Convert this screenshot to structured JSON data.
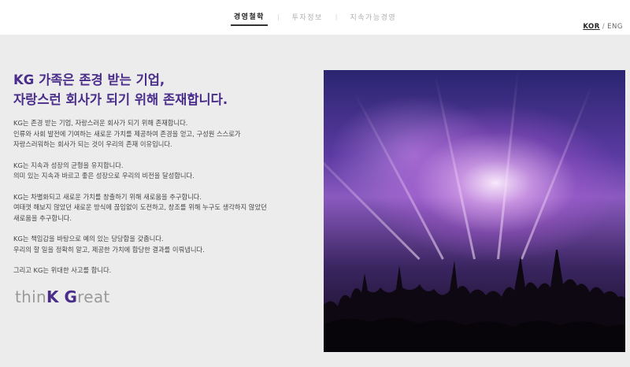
{
  "nav": {
    "items": [
      {
        "label": "경영철학",
        "active": true
      },
      {
        "label": "투자정보",
        "active": false
      },
      {
        "label": "지속가능경영",
        "active": false
      }
    ]
  },
  "lang": {
    "kor": "KOR",
    "separator": "/",
    "eng": "ENG"
  },
  "heading": {
    "line1": "KG 가족은 존경 받는 기업,",
    "line2": "자랑스런 회사가 되기 위해 존재합니다."
  },
  "paragraphs": [
    [
      "KG는 존경 받는 기업, 자랑스러운 회사가 되기 위해 존재합니다.",
      "인류와 사회 발전에 기여하는 새로운 가치를 제공하여 존경을 얻고, 구성원 스스로가",
      "자랑스러워하는 회사가 되는 것이 우리의 존재 이유입니다."
    ],
    [
      "KG는 지속과 성장의 균형을 유지합니다.",
      "의미 있는 지속과 바르고 좋은 성장으로 우리의 비전을 달성합니다."
    ],
    [
      "KG는 차별화되고 새로운 가치를 창출하기 위해 새로움을 추구합니다.",
      "여태껏 해보지 않았던 새로운 방식에 끊임없이 도전하고, 창조를 위해 누구도 생각하지 않았던",
      "새로움을 추구합니다."
    ],
    [
      "KG는 책임감을 바탕으로 예의 있는 당당함을 갖춥니다.",
      "우리의 할 일을 정확히 알고, 제공한 가치에 합당한 결과를 이뤄냅니다."
    ],
    [
      "그리고 KG는 위대한 사고를 합니다."
    ]
  ],
  "logo": {
    "part1": "thin",
    "part2": "K",
    "part3": " ",
    "part4": "G",
    "part5": "reat"
  },
  "colors": {
    "brand": "#4a2d8a",
    "logo_gray": "#9a9a9a"
  },
  "hero": {
    "icon": "concert-crowd-image"
  }
}
